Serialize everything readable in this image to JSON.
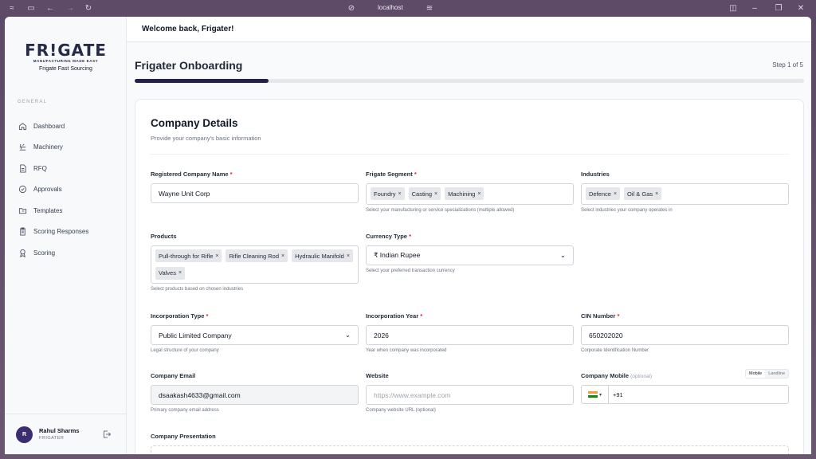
{
  "browser": {
    "url": "localhost"
  },
  "sidebar": {
    "logo": {
      "text": "FR!GATE",
      "tagline": "MANUFACTURING MADE EASY",
      "subtitle": "Frigate Fast Sourcing"
    },
    "section_heading": "GENERAL",
    "items": [
      {
        "label": "Dashboard",
        "icon": "home-icon"
      },
      {
        "label": "Machinery",
        "icon": "machinery-icon"
      },
      {
        "label": "RFQ",
        "icon": "document-icon"
      },
      {
        "label": "Approvals",
        "icon": "check-circle-icon"
      },
      {
        "label": "Templates",
        "icon": "folder-icon"
      },
      {
        "label": "Scoring Responses",
        "icon": "clipboard-icon"
      },
      {
        "label": "Scoring",
        "icon": "award-icon"
      }
    ],
    "user": {
      "initial": "R",
      "name": "Rahul Sharms",
      "role": "FRIGATER"
    }
  },
  "header": {
    "welcome": "Welcome back, Frigater!"
  },
  "onboarding": {
    "title": "Frigater Onboarding",
    "step": "Step 1 of 5",
    "progress_fraction": 0.2
  },
  "form": {
    "title": "Company Details",
    "subtitle": "Provide your company's basic information",
    "registered_name": {
      "label": "Registered Company Name",
      "value": "Wayne Unit Corp"
    },
    "segment": {
      "label": "Frigate Segment",
      "tags": [
        "Foundry",
        "Casting",
        "Machining"
      ],
      "hint": "Select your manufacturing or service specializations (multiple allowed)"
    },
    "industries": {
      "label": "Industries",
      "tags": [
        "Defence",
        "Oil & Gas"
      ],
      "hint": "Select industries your company operates in"
    },
    "products": {
      "label": "Products",
      "tags": [
        "Pull-through for Rifle",
        "Rifle Cleaning Rod",
        "Hydraulic Manifold",
        "Valves"
      ],
      "hint": "Select products based on chosen industries"
    },
    "currency": {
      "label": "Currency Type",
      "value": "₹ Indian Rupee",
      "hint": "Select your preferred transaction currency"
    },
    "incorporation_type": {
      "label": "Incorporation Type",
      "value": "Public Limited Company",
      "hint": "Legal structure of your company"
    },
    "incorporation_year": {
      "label": "Incorporation Year",
      "value": "2026",
      "hint": "Year when company was incorporated"
    },
    "cin": {
      "label": "CIN Number",
      "value": "650202020",
      "hint": "Corporate Identification Number"
    },
    "email": {
      "label": "Company Email",
      "value": "dsaakash4633@gmail.com",
      "hint": "Primary company email address"
    },
    "website": {
      "label": "Website",
      "placeholder": "https://www.example.com",
      "hint": "Company website URL (optional)"
    },
    "mobile": {
      "label": "Company Mobile",
      "optional": "(optional)",
      "toggle": [
        "Mobile",
        "Landline"
      ],
      "prefix": "+91"
    },
    "presentation": {
      "label": "Company Presentation"
    }
  }
}
